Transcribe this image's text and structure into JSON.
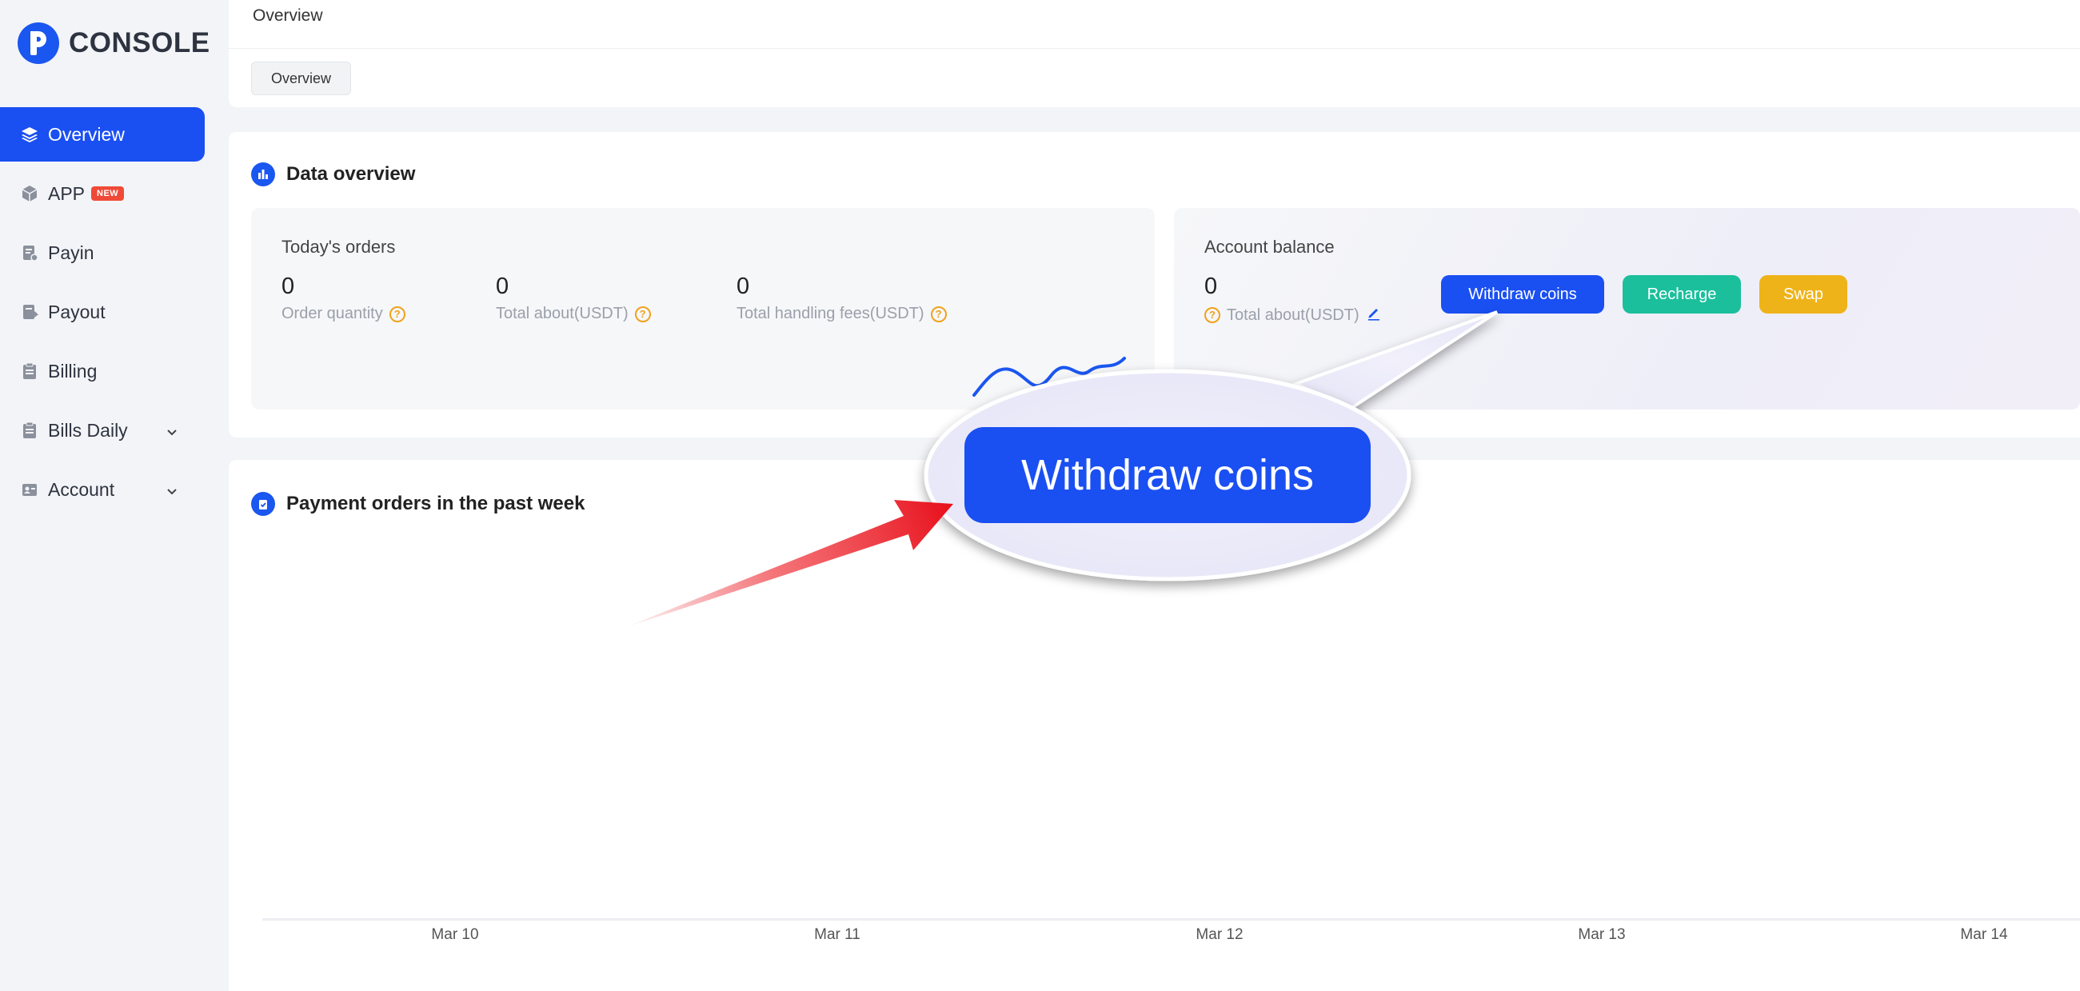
{
  "brand": {
    "name": "CONSOLE"
  },
  "sidebar": {
    "items": [
      {
        "label": "Overview",
        "icon": "layers-icon",
        "active": true
      },
      {
        "label": "APP",
        "icon": "cube-icon",
        "badge": "NEW"
      },
      {
        "label": "Payin",
        "icon": "payin-icon"
      },
      {
        "label": "Payout",
        "icon": "payout-icon"
      },
      {
        "label": "Billing",
        "icon": "clipboard-icon"
      },
      {
        "label": "Bills Daily",
        "icon": "clipboard-icon",
        "expandable": true
      },
      {
        "label": "Account",
        "icon": "id-card-icon",
        "expandable": true
      }
    ]
  },
  "header": {
    "title": "Overview",
    "tabs": [
      "Overview"
    ]
  },
  "data_overview": {
    "title": "Data overview",
    "todays_orders": {
      "title": "Today's orders",
      "stats": [
        {
          "value": "0",
          "label": "Order quantity"
        },
        {
          "value": "0",
          "label": "Total about(USDT)"
        },
        {
          "value": "0",
          "label": "Total handling fees(USDT)"
        }
      ]
    },
    "account_balance": {
      "title": "Account balance",
      "value": "0",
      "label": "Total about(USDT)",
      "buttons": {
        "withdraw": "Withdraw coins",
        "recharge": "Recharge",
        "swap": "Swap"
      }
    }
  },
  "payment_orders": {
    "title": "Payment orders in the past week",
    "x_labels": [
      "Mar 10",
      "Mar 11",
      "Mar 12",
      "Mar 13",
      "Mar 14"
    ]
  },
  "callout": {
    "label": "Withdraw coins"
  },
  "colors": {
    "primary": "#1a4ff2",
    "recharge": "#1bbf9c",
    "swap": "#efb31a",
    "badge": "#ef4a38",
    "hint": "#f0a21b",
    "arrow": "#e8202a"
  }
}
